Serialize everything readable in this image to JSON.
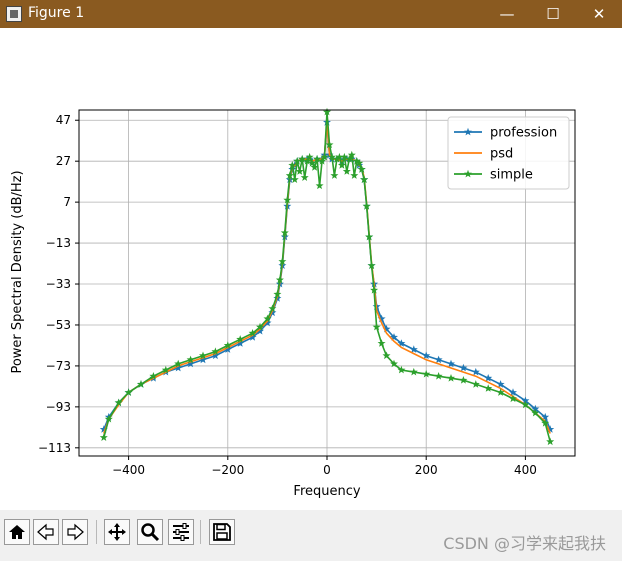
{
  "window": {
    "title": "Figure 1",
    "buttons": {
      "minimize": "—",
      "maximize": "☐",
      "close": "✕"
    }
  },
  "toolbar": {
    "icons": [
      "home-icon",
      "back-icon",
      "forward-icon",
      "pan-icon",
      "zoom-icon",
      "configure-subplots-icon",
      "save-icon"
    ],
    "watermark": "CSDN @习学来起我扶"
  },
  "chart_data": {
    "type": "line",
    "title": "",
    "xlabel": "Frequency",
    "ylabel": "Power Spectral Density (dB/Hz)",
    "xlim": [
      -500,
      500
    ],
    "ylim": [
      -117,
      52
    ],
    "xticks": [
      -400,
      -200,
      0,
      200,
      400
    ],
    "xtick_labels": [
      "−400",
      "−200",
      "0",
      "200",
      "400"
    ],
    "yticks": [
      47,
      27,
      7,
      -13,
      -33,
      -53,
      -73,
      -93,
      -113
    ],
    "ytick_labels": [
      "47",
      "27",
      "7",
      "−13",
      "−33",
      "−53",
      "−73",
      "−93",
      "−113"
    ],
    "grid": true,
    "legend_position": "top-right",
    "legend": [
      "profession",
      "psd",
      "simple"
    ],
    "series": [
      {
        "name": "profession",
        "color": "#1f77b4",
        "marker": "star",
        "x": [
          -450,
          -440,
          -420,
          -400,
          -375,
          -350,
          -325,
          -300,
          -275,
          -250,
          -225,
          -200,
          -175,
          -150,
          -135,
          -120,
          -110,
          -100,
          -95,
          -90,
          -85,
          -80,
          -75,
          -70,
          -65,
          -60,
          -50,
          -40,
          -30,
          -20,
          -10,
          -5,
          0,
          5,
          10,
          20,
          30,
          40,
          50,
          60,
          65,
          70,
          75,
          80,
          85,
          90,
          95,
          100,
          110,
          120,
          135,
          150,
          175,
          200,
          225,
          250,
          275,
          300,
          325,
          350,
          375,
          400,
          420,
          440,
          450
        ],
        "y": [
          -104,
          -98,
          -91,
          -86,
          -82,
          -79,
          -76,
          -74,
          -72,
          -70,
          -68,
          -65,
          -62,
          -59,
          -56,
          -52,
          -47,
          -40,
          -33,
          -24,
          -10,
          5,
          18,
          23,
          25,
          27,
          28,
          28,
          27,
          28,
          28,
          30,
          46,
          30,
          28,
          28,
          27,
          28,
          28,
          27,
          25,
          23,
          18,
          5,
          -10,
          -24,
          -33,
          -44,
          -50,
          -55,
          -59,
          -62,
          -65,
          -68,
          -70,
          -72,
          -74,
          -76,
          -79,
          -82,
          -86,
          -90,
          -94,
          -98,
          -104
        ]
      },
      {
        "name": "psd",
        "color": "#ff7f0e",
        "marker": "none",
        "x": [
          -450,
          -440,
          -420,
          -400,
          -375,
          -350,
          -325,
          -300,
          -275,
          -250,
          -225,
          -200,
          -175,
          -150,
          -135,
          -120,
          -110,
          -100,
          -95,
          -90,
          -85,
          -80,
          -75,
          -70,
          -65,
          -60,
          -50,
          -40,
          -30,
          -20,
          -10,
          -5,
          0,
          5,
          10,
          20,
          30,
          40,
          50,
          60,
          65,
          70,
          75,
          80,
          85,
          90,
          95,
          100,
          110,
          120,
          135,
          150,
          175,
          200,
          225,
          250,
          275,
          300,
          325,
          350,
          375,
          400,
          420,
          440,
          450
        ],
        "y": [
          -106,
          -99,
          -92,
          -86,
          -82,
          -79,
          -76,
          -73,
          -71,
          -69,
          -67,
          -64,
          -61,
          -58,
          -55,
          -51,
          -46,
          -39,
          -32,
          -23,
          -9,
          6,
          19,
          24,
          25,
          27,
          28,
          28,
          27,
          28,
          28,
          30,
          46,
          30,
          28,
          28,
          27,
          28,
          28,
          27,
          25,
          24,
          19,
          6,
          -9,
          -23,
          -33,
          -46,
          -52,
          -57,
          -61,
          -64,
          -67,
          -70,
          -72,
          -74,
          -76,
          -78,
          -81,
          -84,
          -88,
          -92,
          -96,
          -100,
          -106
        ]
      },
      {
        "name": "simple",
        "color": "#2ca02c",
        "marker": "star",
        "x": [
          -450,
          -440,
          -420,
          -400,
          -375,
          -350,
          -325,
          -300,
          -275,
          -250,
          -225,
          -200,
          -175,
          -150,
          -135,
          -120,
          -110,
          -100,
          -95,
          -90,
          -85,
          -80,
          -75,
          -70,
          -65,
          -60,
          -55,
          -50,
          -45,
          -40,
          -35,
          -30,
          -25,
          -20,
          -15,
          -10,
          -5,
          0,
          5,
          10,
          15,
          20,
          25,
          30,
          35,
          40,
          45,
          50,
          55,
          60,
          65,
          70,
          75,
          80,
          85,
          90,
          95,
          100,
          110,
          120,
          135,
          150,
          175,
          200,
          225,
          250,
          275,
          300,
          325,
          350,
          375,
          400,
          420,
          440,
          450
        ],
        "y": [
          -108,
          -99,
          -91,
          -86,
          -82,
          -78,
          -75,
          -72,
          -70,
          -68,
          -66,
          -63,
          -60,
          -57,
          -54,
          -50,
          -45,
          -38,
          -31,
          -22,
          -8,
          8,
          20,
          25,
          18,
          27,
          22,
          28,
          19,
          27,
          29,
          26,
          24,
          28,
          15,
          27,
          29,
          51,
          35,
          29,
          20,
          28,
          29,
          25,
          29,
          22,
          28,
          30,
          20,
          27,
          26,
          23,
          18,
          5,
          -10,
          -24,
          -36,
          -54,
          -62,
          -68,
          -72,
          -75,
          -76,
          -77,
          -78,
          -79,
          -80,
          -82,
          -84,
          -86,
          -89,
          -92,
          -96,
          -101,
          -110
        ]
      }
    ]
  }
}
